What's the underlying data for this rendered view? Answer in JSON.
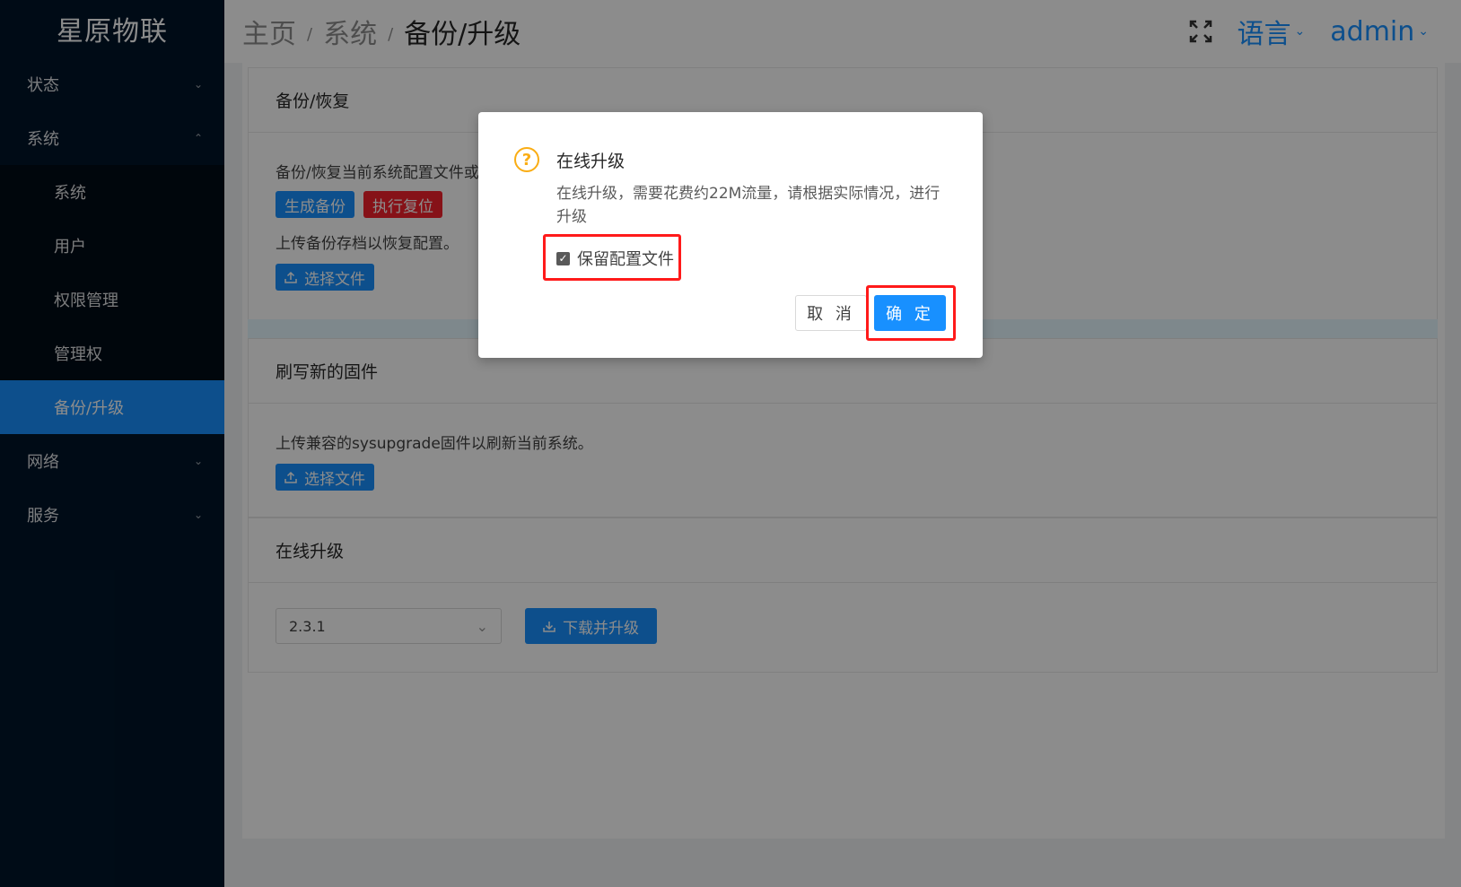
{
  "app": {
    "logo": "星原物联"
  },
  "sidebar": {
    "items": [
      {
        "label": "状态",
        "caret": "⌄"
      },
      {
        "label": "系统",
        "caret": "⌃"
      },
      {
        "label": "系统"
      },
      {
        "label": "用户"
      },
      {
        "label": "权限管理"
      },
      {
        "label": "管理权"
      },
      {
        "label": "备份/升级"
      },
      {
        "label": "网络",
        "caret": "⌄"
      },
      {
        "label": "服务",
        "caret": "⌄"
      }
    ]
  },
  "header": {
    "breadcrumb": [
      "主页",
      "系统",
      "备份/升级"
    ],
    "separator": "/",
    "language": "语言",
    "user": "admin",
    "chevron": "⌄"
  },
  "backup_card": {
    "title": "备份/恢复",
    "desc": "备份/恢复当前系统配置文件或",
    "btn_backup": "生成备份",
    "btn_reset": "执行复位",
    "upload_desc": "上传备份存档以恢复配置。",
    "btn_choose": "选择文件"
  },
  "flash_card": {
    "title": "刷写新的固件",
    "desc": "上传兼容的sysupgrade固件以刷新当前系统。",
    "btn_choose": "选择文件"
  },
  "online_card": {
    "title": "在线升级",
    "version": "2.3.1",
    "btn_download": "下载并升级"
  },
  "modal": {
    "title": "在线升级",
    "content": "在线升级，需要花费约22M流量，请根据实际情况，进行升级",
    "checkbox_label": "保留配置文件",
    "checkbox_checked": true,
    "cancel": "取 消",
    "ok": "确 定"
  },
  "colors": {
    "primary": "#1890ff",
    "danger": "#f5222d",
    "warning": "#faad14",
    "sidebar": "#001529",
    "highlight": "#ff1a1a"
  }
}
